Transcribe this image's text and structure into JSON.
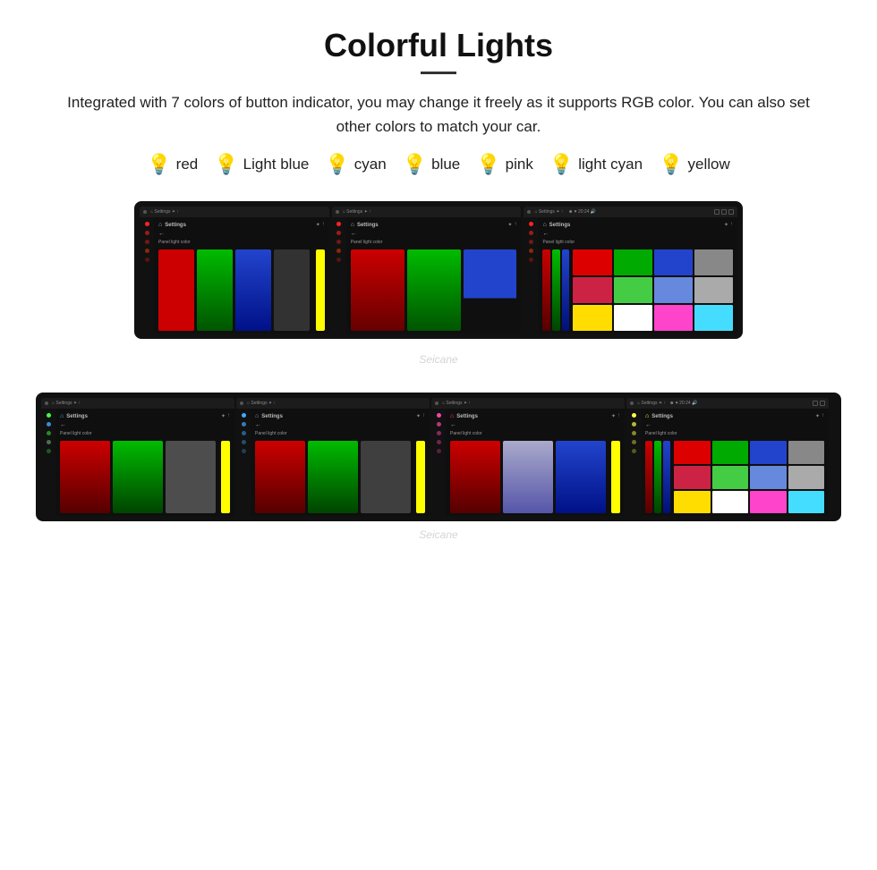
{
  "page": {
    "title": "Colorful Lights",
    "description": "Integrated with 7 colors of button indicator, you may change it freely as it supports RGB color. You can also set other colors to match your car.",
    "colors": [
      {
        "name": "red",
        "color": "#ff2222",
        "bulb": "🔴"
      },
      {
        "name": "Light blue",
        "color": "#99ccff",
        "bulb": "💧"
      },
      {
        "name": "cyan",
        "color": "#00ffff",
        "bulb": "💠"
      },
      {
        "name": "blue",
        "color": "#4488ff",
        "bulb": "🔵"
      },
      {
        "name": "pink",
        "color": "#ff44cc",
        "bulb": "💗"
      },
      {
        "name": "light cyan",
        "color": "#aaffee",
        "bulb": "🔷"
      },
      {
        "name": "yellow",
        "color": "#ffee00",
        "bulb": "💛"
      }
    ],
    "watermark": "Seicane",
    "topScreens": {
      "count": 3,
      "screens": [
        {
          "label": "Settings",
          "bars": [
            {
              "color": "#cc0000",
              "height": "100%"
            },
            {
              "color": "#00bb00",
              "height": "80%"
            },
            {
              "color": "#0044cc",
              "height": "100%"
            }
          ],
          "accent": "#ffff00"
        },
        {
          "label": "Settings",
          "bars": [
            {
              "color": "#cc0000",
              "height": "100%"
            },
            {
              "color": "#00bb00",
              "height": "80%"
            },
            {
              "color": "#0044cc",
              "height": "60%"
            }
          ],
          "accent": null
        },
        {
          "label": "Settings",
          "hasSwatches": true,
          "bars": [
            {
              "color": "#cc0000",
              "height": "100%"
            },
            {
              "color": "#00bb00",
              "height": "80%"
            },
            {
              "color": "#0044cc",
              "height": "100%"
            }
          ],
          "swatches": [
            "#dd0000",
            "#00aa00",
            "#2244cc",
            "#888888",
            "#cc3344",
            "#44cc44",
            "#6688dd",
            "#aaaaaa",
            "#ffdd00",
            "#ffffff",
            "#ff44cc",
            "#44ddff"
          ]
        }
      ]
    },
    "bottomScreens": {
      "count": 4,
      "screens": [
        {
          "label": "Settings",
          "bars": [
            {
              "color": "#cc0000"
            },
            {
              "color": "#00bb00"
            },
            {
              "color": "#ffffff"
            }
          ],
          "accentBar": {
            "color": "#ffff00"
          }
        },
        {
          "label": "Settings",
          "bars": [
            {
              "color": "#cc0000"
            },
            {
              "color": "#00bb00"
            },
            {
              "color": "#dddddd"
            }
          ],
          "accentBar": {
            "color": "#ffff00"
          }
        },
        {
          "label": "Settings",
          "bars": [
            {
              "color": "#cc0000"
            },
            {
              "color": "#aaaacc"
            },
            {
              "color": "#0044cc"
            }
          ],
          "accentBar": {
            "color": "#ffff00"
          }
        },
        {
          "label": "Settings",
          "hasSwatches": true,
          "bars": [
            {
              "color": "#cc0000"
            },
            {
              "color": "#00bb00"
            },
            {
              "color": "#0044cc"
            }
          ],
          "swatches": [
            "#dd0000",
            "#00aa00",
            "#2244cc",
            "#888888",
            "#cc3344",
            "#44cc44",
            "#6688dd",
            "#aaaaaa",
            "#ffdd00",
            "#ffffff",
            "#ff44cc",
            "#44ddff"
          ]
        }
      ]
    }
  }
}
